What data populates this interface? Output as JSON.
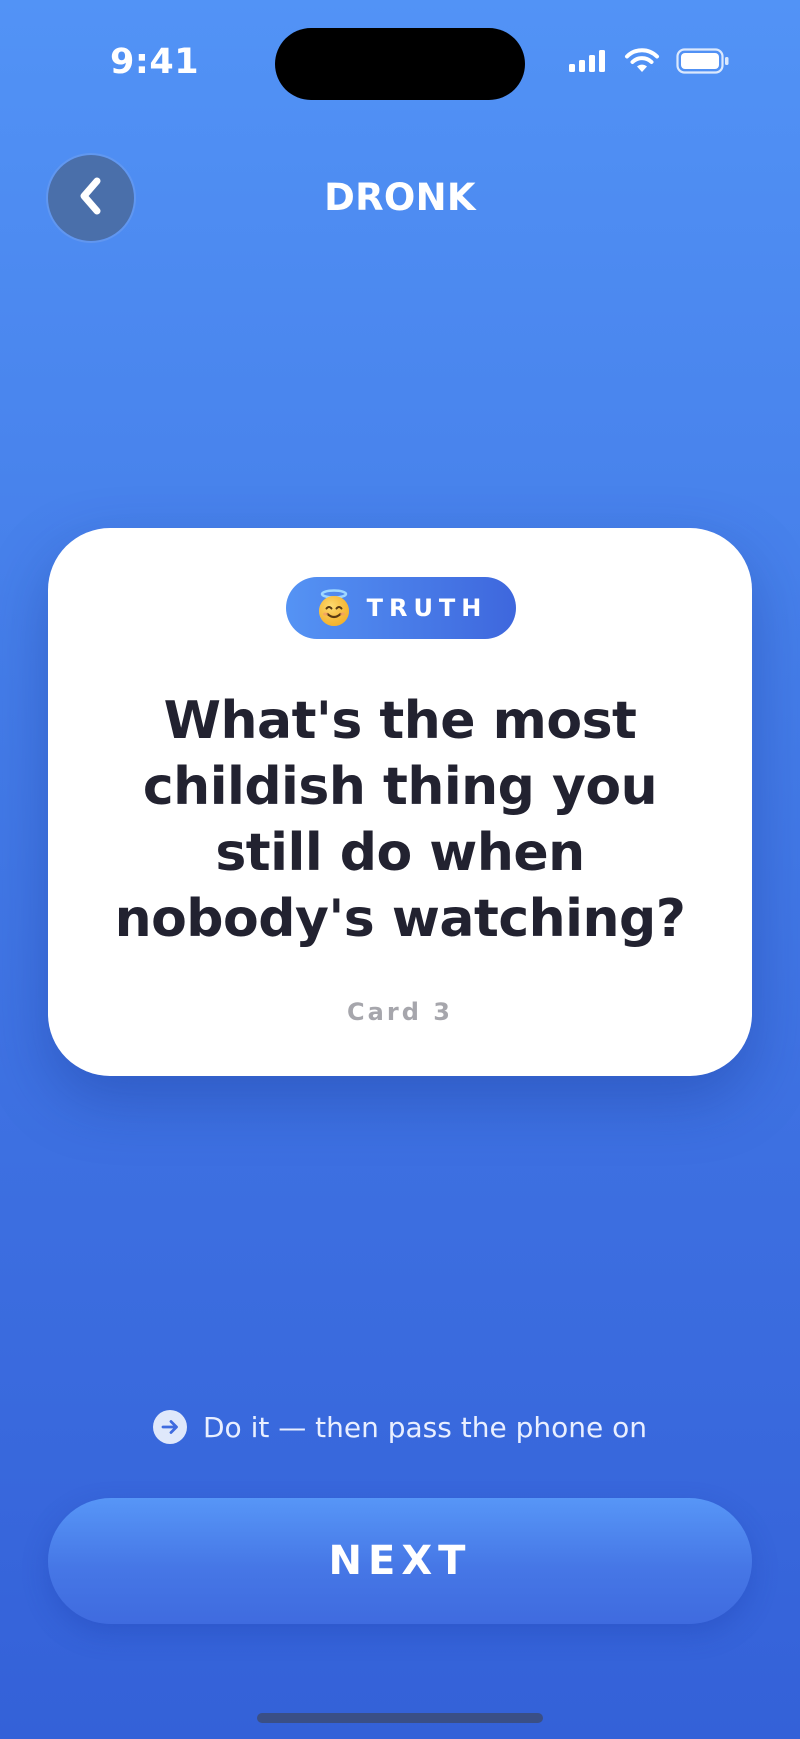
{
  "status_bar": {
    "time": "9:41"
  },
  "header": {
    "title": "DRONK",
    "back_icon": "chevron-left-icon"
  },
  "card": {
    "type_label": "TRUTH",
    "type_icon": "smiling-face-with-halo-emoji",
    "question_lines": [
      "What's the most",
      "childish thing you",
      "still do when",
      "nobody's watching?"
    ],
    "counter": "Card 3"
  },
  "hint": {
    "icon": "arrow-right-circle-icon",
    "text": "Do it — then pass the phone on"
  },
  "next_button": {
    "label": "NEXT"
  },
  "colors": {
    "background_top": "#5293f6",
    "background_bottom": "#3461d8",
    "card_bg": "#ffffff",
    "question_text": "#222230",
    "badge_start": "#5593f4",
    "badge_end": "#3e67dd"
  }
}
